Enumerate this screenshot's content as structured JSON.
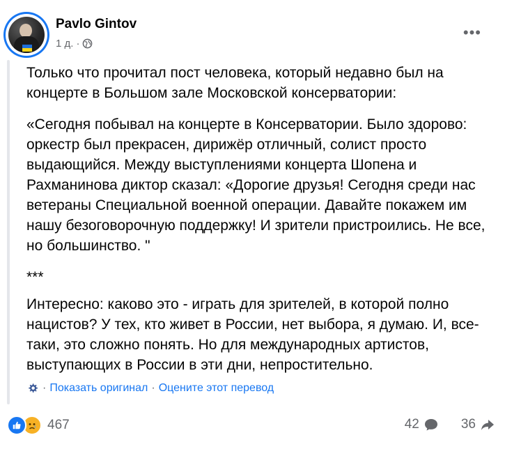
{
  "author": {
    "name": "Pavlo Gintov",
    "time": "1 д.",
    "separator": "·"
  },
  "colors": {
    "link": "#1877f2",
    "muted": "#65676b",
    "like": "#1877f2",
    "sad": "#f7b125"
  },
  "post": {
    "paragraphs": [
      "Только что прочитал пост человека, который недавно был на концерте в Большом зале Московской консерватории:",
      "«Сегодня побывал на концерте в Консерватории. Было здорово: оркестр был прекрасен, дирижёр отличный, солист просто выдающийся. Между выступлениями концерта Шопена и Рахманинова диктор сказал: «Дорогие друзья! Сегодня среди нас ветераны Специальной военной операции. Давайте покажем им нашу безоговорочную поддержку! И зрители пристроились. Не все, но большинство. \"",
      "***",
      "Интересно: каково это - играть для зрителей, в которой полно нацистов? У тех, кто живет в России, нет выбора, я думаю. И, все-таки, это сложно понять. Но для международных артистов, выступающих в России в эти дни, непростительно."
    ]
  },
  "translation": {
    "separator": "·",
    "show_original": "Показать оригинал",
    "rate": "Оцените этот перевод"
  },
  "footer": {
    "reactions_count": "467",
    "comments_count": "42",
    "shares_count": "36",
    "icons": [
      "like-icon",
      "sad-icon",
      "comment-icon",
      "share-icon"
    ]
  }
}
